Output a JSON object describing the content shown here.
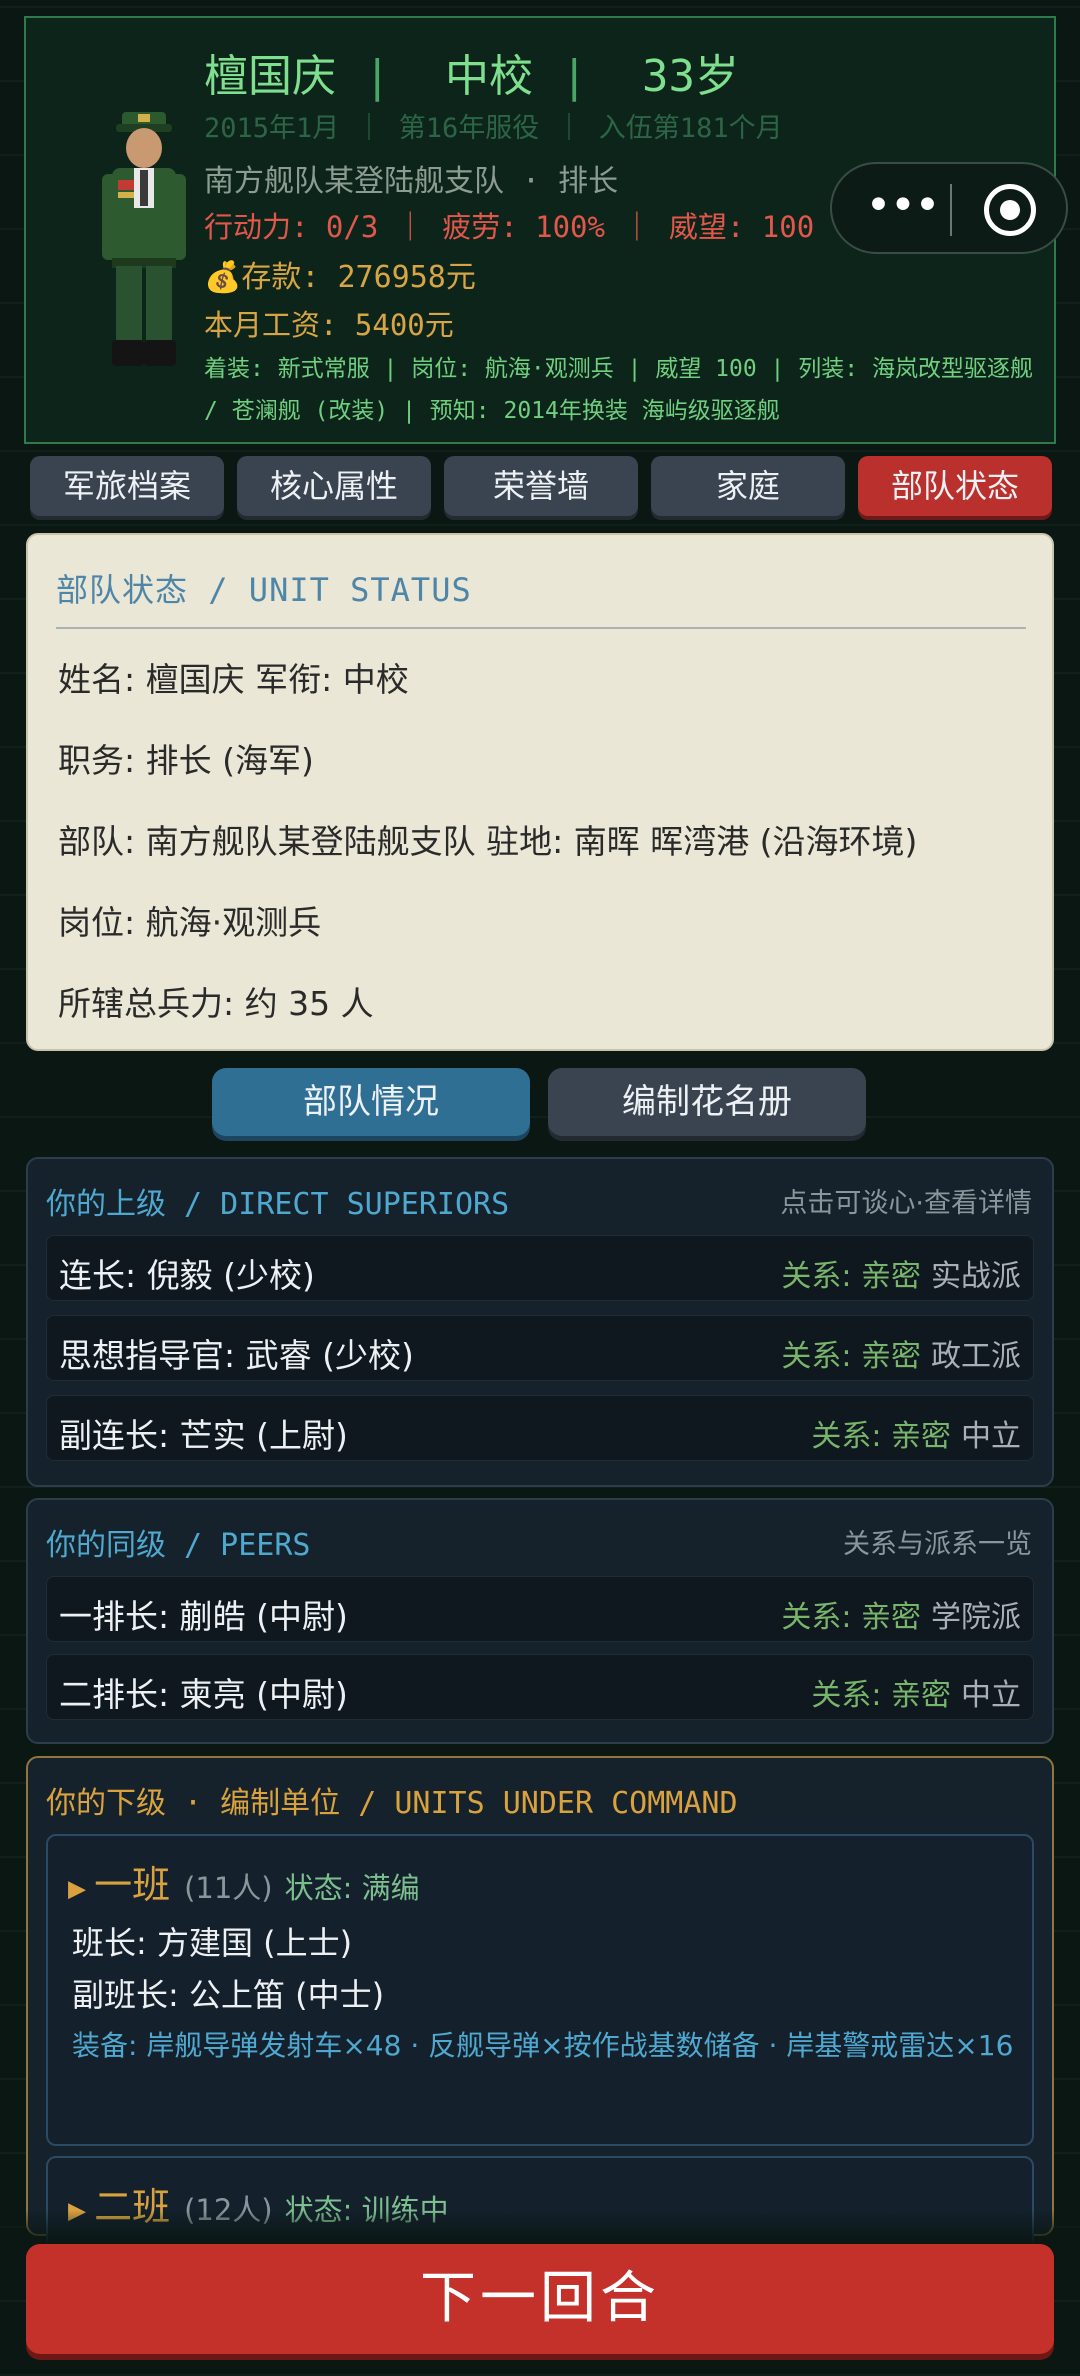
{
  "profile": {
    "name": "檀国庆",
    "rank": "中校",
    "age": "33岁",
    "service": "2015年1月 ｜ 第16年服役 ｜ 入伍第181个月",
    "unit_post": "南方舰队某登陆舰支队 · 排长",
    "stats": "行动力: 0/3 ｜ 疲劳: 100% ｜ 威望: 100",
    "savings": "存款: 276958元",
    "salary": "本月工资: 5400元",
    "details": "着装: 新式常服 | 岗位: 航海·观测兵 | 威望 100 | 列装: 海岚改型驱逐舰 / 苍澜舰 (改装) | 预知: 2014年换装 海屿级驱逐舰"
  },
  "capsule": {
    "menu_icon": "more-dots-icon",
    "close_icon": "target-icon"
  },
  "tabs": [
    "军旅档案",
    "核心属性",
    "荣誉墙",
    "家庭",
    "部队状态"
  ],
  "status": {
    "title": "部队状态 / UNIT STATUS",
    "line1": "姓名: 檀国庆   军衔: 中校",
    "line2": "职务: 排长 (海军)",
    "line3": "部队: 南方舰队某登陆舰支队   驻地: 南晖 晖湾港 (沿海环境)",
    "line4": "岗位: 航海·观测兵",
    "line5": "所辖总兵力: 约 35 人"
  },
  "subtabs": [
    "部队情况",
    "编制花名册"
  ],
  "superiors": {
    "title": "你的上级 / DIRECT SUPERIORS",
    "hint": "点击可谈心·查看详情",
    "rows": [
      {
        "name": "连长: 倪毅 (少校)",
        "rel": "关系: 亲密",
        "faction": "实战派"
      },
      {
        "name": "思想指导官: 武睿 (少校)",
        "rel": "关系: 亲密",
        "faction": "政工派"
      },
      {
        "name": "副连长: 芒实 (上尉)",
        "rel": "关系: 亲密",
        "faction": "中立"
      }
    ]
  },
  "peers": {
    "title": "你的同级 / PEERS",
    "hint": "关系与派系一览",
    "rows": [
      {
        "name": "一排长: 蒯皓 (中尉)",
        "rel": "关系: 亲密",
        "faction": "学院派"
      },
      {
        "name": "二排长: 柬亮 (中尉)",
        "rel": "关系: 亲密",
        "faction": "中立"
      }
    ]
  },
  "subordinates": {
    "title": "你的下级 · 编制单位 / UNITS UNDER COMMAND",
    "units": [
      {
        "name": "一班",
        "count": "(11人)",
        "status": "状态: 满编",
        "leader": "班长: 方建国 (上士)",
        "deputy": "副班长: 公上笛 (中士)",
        "equipment": "装备: 岸舰导弹发射车×48 · 反舰导弹×按作战基数储备 · 岸基警戒雷达×16"
      },
      {
        "name": "二班",
        "count": "(12人)",
        "status": "状态: 训练中"
      }
    ]
  },
  "next_turn": "下一回合",
  "colors": {
    "accent_green": "#7ee08f",
    "alert_red": "#c4302a",
    "gold": "#d9a23f",
    "blue": "#4fa8cf"
  }
}
